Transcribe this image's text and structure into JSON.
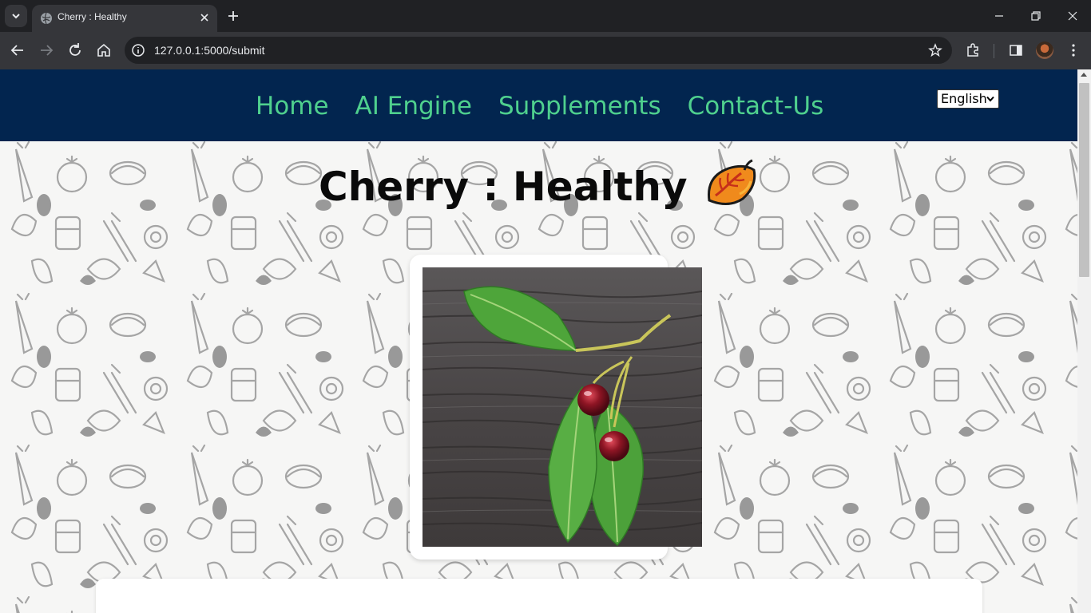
{
  "browser": {
    "tab_title": "Cherry : Healthy",
    "url": "127.0.0.1:5000/submit"
  },
  "site": {
    "nav": {
      "home": "Home",
      "ai_engine": "AI Engine",
      "supplements": "Supplements",
      "contact": "Contact-Us"
    },
    "language": {
      "selected": "English"
    },
    "result_title": "Cherry : Healthy",
    "accent_color": "#4fd08e",
    "nav_background": "#02254f"
  },
  "icons": [
    "tab-search-icon",
    "globe-icon",
    "close-icon",
    "plus-icon",
    "minimize-icon",
    "restore-icon",
    "back-icon",
    "forward-icon",
    "reload-icon",
    "home-icon",
    "info-icon",
    "star-icon",
    "extensions-icon",
    "sidepanel-icon",
    "menu-icon",
    "leaf-icon",
    "chevron-down-icon"
  ]
}
